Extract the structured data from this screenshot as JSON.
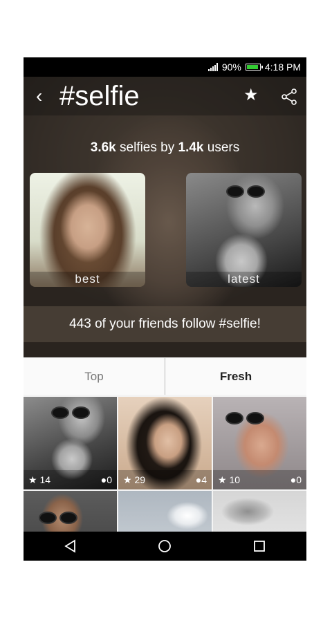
{
  "status_bar": {
    "battery_percent": "90%",
    "time": "4:18 PM"
  },
  "header": {
    "back_icon": "chevron-left-icon",
    "title": "#selfie",
    "favorite_icon": "star-icon",
    "share_icon": "share-icon"
  },
  "stats": {
    "selfies_count": "3.6k",
    "selfies_label": " selfies by ",
    "users_count": "1.4k",
    "users_label": " users"
  },
  "highlights": [
    {
      "label": "best"
    },
    {
      "label": "latest"
    }
  ],
  "friends_banner": "443 of your friends follow #selfie!",
  "tabs": [
    {
      "label": "Top",
      "active": false
    },
    {
      "label": "Fresh",
      "active": true
    }
  ],
  "grid": [
    {
      "likes": "14",
      "comments": "0"
    },
    {
      "likes": "29",
      "comments": "4"
    },
    {
      "likes": "10",
      "comments": "0"
    }
  ],
  "nav": {
    "back_icon": "triangle-back-icon",
    "home_icon": "circle-home-icon",
    "recents_icon": "square-recents-icon"
  },
  "colors": {
    "status_bar": "#000000",
    "battery_fill": "#33cc33",
    "tab_divider": "#b9b9b9"
  }
}
